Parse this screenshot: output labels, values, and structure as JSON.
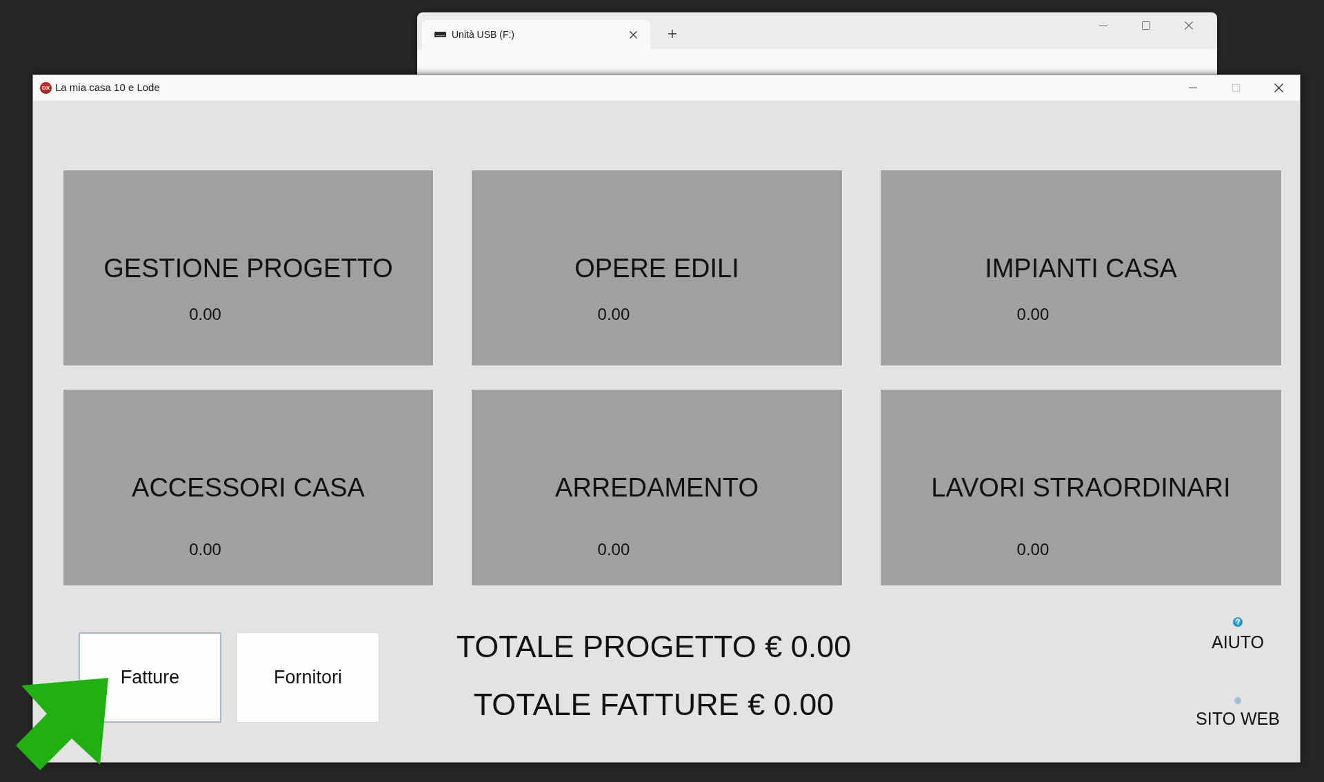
{
  "background_window": {
    "tab": {
      "title": "Unità USB (F:)",
      "selected": true
    }
  },
  "window": {
    "title": "La mia casa 10 e Lode",
    "app_icon_text": "DX",
    "maximize_disabled": true
  },
  "categories": [
    {
      "title": "GESTIONE PROGETTO",
      "amount": "0.00"
    },
    {
      "title": "OPERE EDILI",
      "amount": "0.00"
    },
    {
      "title": "IMPIANTI CASA",
      "amount": "0.00"
    },
    {
      "title": "ACCESSORI CASA",
      "amount": "0.00"
    },
    {
      "title": "ARREDAMENTO",
      "amount": "0.00"
    },
    {
      "title": "LAVORI STRAORDINARI",
      "amount": "0.00"
    }
  ],
  "buttons": [
    {
      "label": "Fatture",
      "focused": true
    },
    {
      "label": "Fornitori",
      "focused": false
    }
  ],
  "totals": [
    "TOTALE PROGETTO € 0.00",
    "TOTALE FATTURE € 0.00"
  ],
  "links": [
    {
      "label": "AIUTO",
      "kind": "help"
    },
    {
      "label": "SITO WEB",
      "kind": "web"
    }
  ]
}
